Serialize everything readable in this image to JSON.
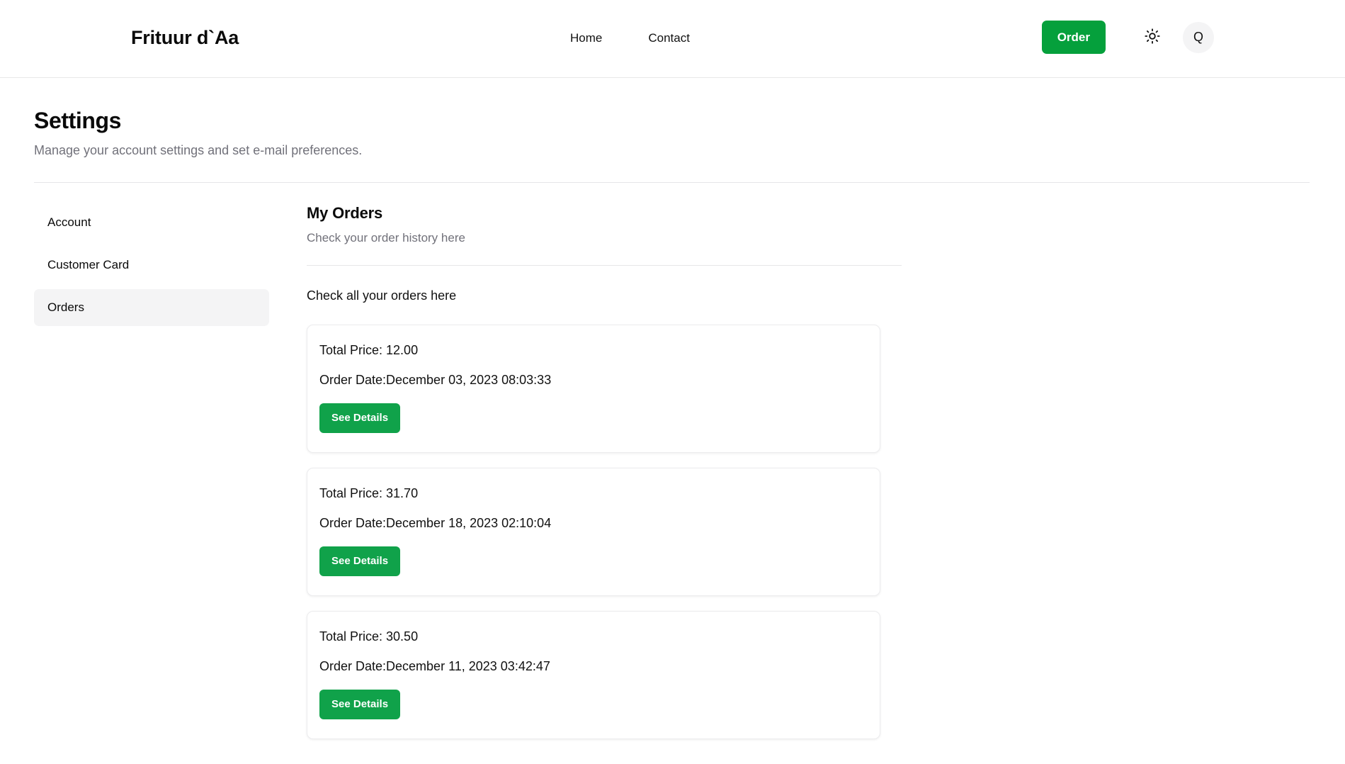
{
  "header": {
    "brand": "Frituur d`Aa",
    "nav": [
      {
        "label": "Home",
        "name": "nav-link-home"
      },
      {
        "label": "Contact",
        "name": "nav-link-contact"
      }
    ],
    "order_button": "Order",
    "theme_icon": "sun-icon",
    "search_icon": "search-icon",
    "search_glyph": "Q",
    "accent_color": "#05a03c"
  },
  "page": {
    "title": "Settings",
    "subtitle": "Manage your account settings and set e-mail preferences."
  },
  "sidebar": {
    "items": [
      {
        "label": "Account",
        "active": false
      },
      {
        "label": "Customer Card",
        "active": false
      },
      {
        "label": "Orders",
        "active": true
      }
    ]
  },
  "content": {
    "title": "My Orders",
    "subtitle": "Check your order history here",
    "intro": "Check all your orders here",
    "price_label": "Total Price: ",
    "date_label": "Order Date:",
    "details_button": "See Details",
    "orders": [
      {
        "price": "12.00",
        "price_line": "Total Price: 12.00",
        "date": "December 03, 2023 08:03:33",
        "date_line": "Order Date:December 03, 2023 08:03:33",
        "details_button": "See Details"
      },
      {
        "price": "31.70",
        "price_line": "Total Price: 31.70",
        "date": "December 18, 2023 02:10:04",
        "date_line": "Order Date:December 18, 2023 02:10:04",
        "details_button": "See Details"
      },
      {
        "price": "30.50",
        "price_line": "Total Price: 30.50",
        "date": "December 11, 2023 03:42:47",
        "date_line": "Order Date:December 11, 2023 03:42:47",
        "details_button": "See Details"
      }
    ]
  },
  "colors": {
    "accent_green": "#05a03c",
    "button_green": "#10a24a",
    "muted_text": "#71717a",
    "active_sidebar_bg": "#f4f4f5",
    "divider": "#e6e6e8"
  }
}
